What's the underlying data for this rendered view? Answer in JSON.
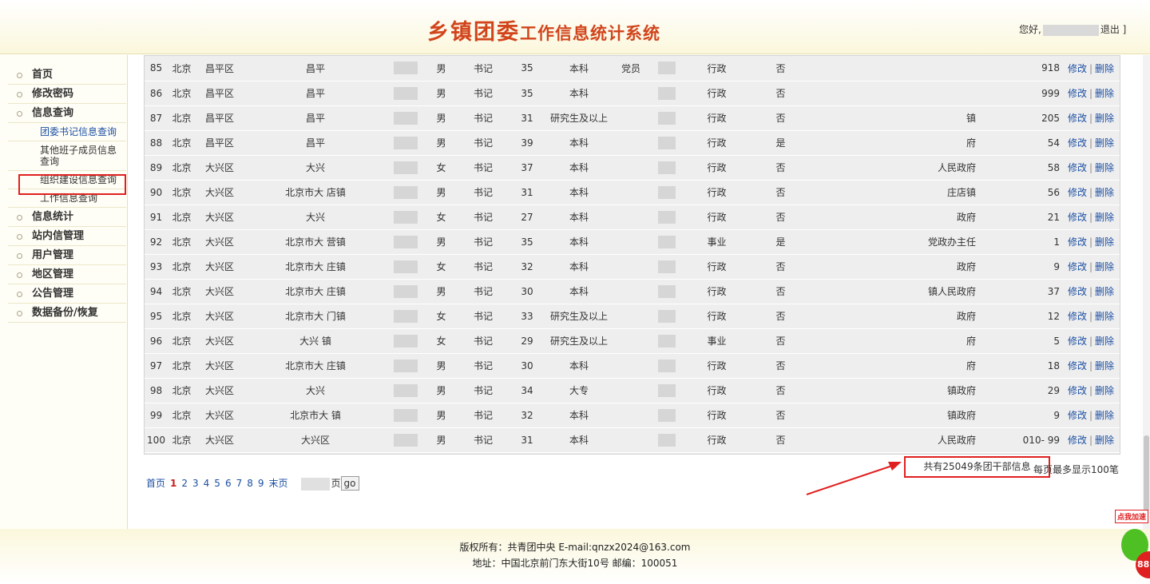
{
  "header": {
    "logo_big": "乡镇团委",
    "logo_small": "工作信息统计系统",
    "greeting": "您好,",
    "logout": "退出 ]"
  },
  "sidebar": {
    "items": [
      {
        "label": "首页"
      },
      {
        "label": "修改密码"
      },
      {
        "label": "信息查询"
      }
    ],
    "subitems": [
      {
        "label": "团委书记信息查询"
      },
      {
        "label": "其他班子成员信息查询"
      },
      {
        "label": "组织建设信息查询"
      },
      {
        "label": "工作信息查询"
      }
    ],
    "items2": [
      {
        "label": "信息统计"
      },
      {
        "label": "站内信管理"
      },
      {
        "label": "用户管理"
      },
      {
        "label": "地区管理"
      },
      {
        "label": "公告管理"
      },
      {
        "label": "数据备份/恢复"
      }
    ]
  },
  "table": {
    "edit_label": "修改",
    "delete_label": "删除",
    "rows": [
      {
        "n": "85",
        "p": "北京",
        "d": "昌平区",
        "t": "昌平",
        "g": "男",
        "r": "书记",
        "a": "35",
        "e": "本科",
        "party": "党员",
        "type": "行政",
        "yn": "否",
        "org": "",
        "ph": "918"
      },
      {
        "n": "86",
        "p": "北京",
        "d": "昌平区",
        "t": "昌平",
        "g": "男",
        "r": "书记",
        "a": "35",
        "e": "本科",
        "party": "",
        "type": "行政",
        "yn": "否",
        "org": "",
        "ph": "999"
      },
      {
        "n": "87",
        "p": "北京",
        "d": "昌平区",
        "t": "昌平",
        "g": "男",
        "r": "书记",
        "a": "31",
        "e": "研究生及以上",
        "party": "",
        "type": "行政",
        "yn": "否",
        "org": "镇",
        "ph": "205"
      },
      {
        "n": "88",
        "p": "北京",
        "d": "昌平区",
        "t": "昌平",
        "g": "男",
        "r": "书记",
        "a": "39",
        "e": "本科",
        "party": "",
        "type": "行政",
        "yn": "是",
        "org": "府",
        "ph": "54"
      },
      {
        "n": "89",
        "p": "北京",
        "d": "大兴区",
        "t": "大兴",
        "g": "女",
        "r": "书记",
        "a": "37",
        "e": "本科",
        "party": "",
        "type": "行政",
        "yn": "否",
        "org": "人民政府",
        "ph": "58"
      },
      {
        "n": "90",
        "p": "北京",
        "d": "大兴区",
        "t": "北京市大 店镇",
        "g": "男",
        "r": "书记",
        "a": "31",
        "e": "本科",
        "party": "",
        "type": "行政",
        "yn": "否",
        "org": "庄店镇",
        "ph": "56"
      },
      {
        "n": "91",
        "p": "北京",
        "d": "大兴区",
        "t": "大兴",
        "g": "女",
        "r": "书记",
        "a": "27",
        "e": "本科",
        "party": "",
        "type": "行政",
        "yn": "否",
        "org": "政府",
        "ph": "21"
      },
      {
        "n": "92",
        "p": "北京",
        "d": "大兴区",
        "t": "北京市大 营镇",
        "g": "男",
        "r": "书记",
        "a": "35",
        "e": "本科",
        "party": "",
        "type": "事业",
        "yn": "是",
        "org": "党政办主任",
        "ph": "1"
      },
      {
        "n": "93",
        "p": "北京",
        "d": "大兴区",
        "t": "北京市大 庄镇",
        "g": "女",
        "r": "书记",
        "a": "32",
        "e": "本科",
        "party": "",
        "type": "行政",
        "yn": "否",
        "org": "政府",
        "ph": "9"
      },
      {
        "n": "94",
        "p": "北京",
        "d": "大兴区",
        "t": "北京市大 庄镇",
        "g": "男",
        "r": "书记",
        "a": "30",
        "e": "本科",
        "party": "",
        "type": "行政",
        "yn": "否",
        "org": "镇人民政府",
        "ph": "37"
      },
      {
        "n": "95",
        "p": "北京",
        "d": "大兴区",
        "t": "北京市大 门镇",
        "g": "女",
        "r": "书记",
        "a": "33",
        "e": "研究生及以上",
        "party": "",
        "type": "行政",
        "yn": "否",
        "org": "政府",
        "ph": "12"
      },
      {
        "n": "96",
        "p": "北京",
        "d": "大兴区",
        "t": "大兴 镇",
        "g": "女",
        "r": "书记",
        "a": "29",
        "e": "研究生及以上",
        "party": "",
        "type": "事业",
        "yn": "否",
        "org": "府",
        "ph": "5"
      },
      {
        "n": "97",
        "p": "北京",
        "d": "大兴区",
        "t": "北京市大 庄镇",
        "g": "男",
        "r": "书记",
        "a": "30",
        "e": "本科",
        "party": "",
        "type": "行政",
        "yn": "否",
        "org": "府",
        "ph": "18"
      },
      {
        "n": "98",
        "p": "北京",
        "d": "大兴区",
        "t": "大兴",
        "g": "男",
        "r": "书记",
        "a": "34",
        "e": "大专",
        "party": "",
        "type": "行政",
        "yn": "否",
        "org": "镇政府",
        "ph": "29"
      },
      {
        "n": "99",
        "p": "北京",
        "d": "大兴区",
        "t": "北京市大 镇",
        "g": "男",
        "r": "书记",
        "a": "32",
        "e": "本科",
        "party": "",
        "type": "行政",
        "yn": "否",
        "org": "镇政府",
        "ph": "9"
      },
      {
        "n": "100",
        "p": "北京",
        "d": "大兴区",
        "t": "大兴区",
        "g": "男",
        "r": "书记",
        "a": "31",
        "e": "本科",
        "party": "",
        "type": "行政",
        "yn": "否",
        "org": "人民政府",
        "ph": "010- 99"
      }
    ]
  },
  "pager": {
    "first": "首页",
    "current": "1",
    "pages": [
      "2",
      "3",
      "4",
      "5",
      "6",
      "7",
      "8",
      "9"
    ],
    "last": "末页",
    "page_unit": "页",
    "go": "go"
  },
  "summary": {
    "total": "共有25049条团干部信息",
    "per_page": "每页最多显示100笔"
  },
  "footer": {
    "line1": "版权所有：共青团中央 E-mail:qnzx2024@163.com",
    "line2": "地址：中国北京前门东大街10号 邮编：100051"
  },
  "float_ad": {
    "tag": "点我加速",
    "badge": "88"
  }
}
